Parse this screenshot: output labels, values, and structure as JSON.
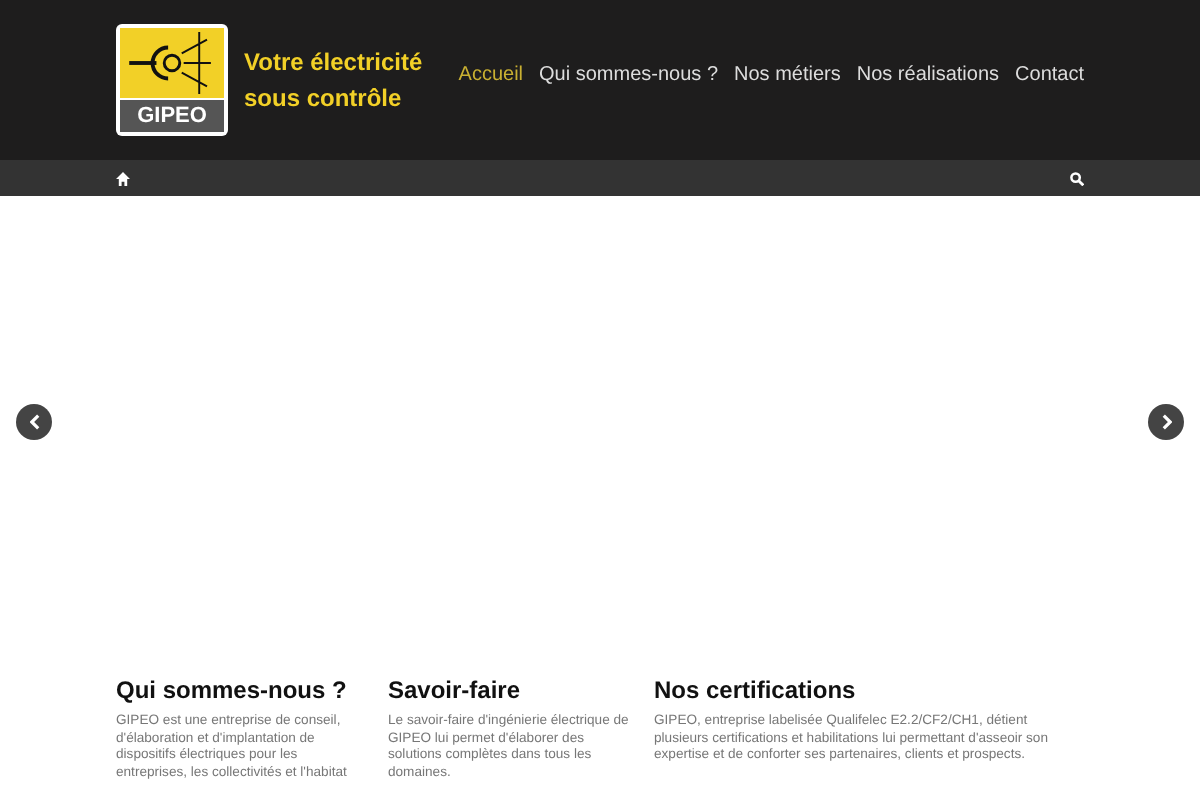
{
  "header": {
    "logo_text": "GIPEO",
    "tagline": "Votre électricité sous contrôle",
    "nav": [
      {
        "label": "Accueil",
        "selected": true
      },
      {
        "label": "Qui sommes-nous ?",
        "selected": false
      },
      {
        "label": "Nos métiers",
        "selected": false
      },
      {
        "label": "Nos réalisations",
        "selected": false
      },
      {
        "label": "Contact",
        "selected": false
      }
    ]
  },
  "columns": [
    {
      "title": "Qui sommes-nous ?",
      "text": "GIPEO est une entreprise de conseil, d'élaboration et d'implantation de dispositifs électriques pour les entreprises, les collectivités et l'habitat"
    },
    {
      "title": "Savoir-faire",
      "text": "Le savoir-faire d'ingénierie électrique de GIPEO lui permet d'élaborer des solutions complètes dans tous les domaines."
    },
    {
      "title": "Nos certifications",
      "text": "GIPEO, entreprise labelisée Qualifelec E2.2/CF2/CH1, détient plusieurs certifications et habilitations lui permettant d'asseoir son expertise et de conforter ses partenaires, clients et prospects."
    }
  ]
}
